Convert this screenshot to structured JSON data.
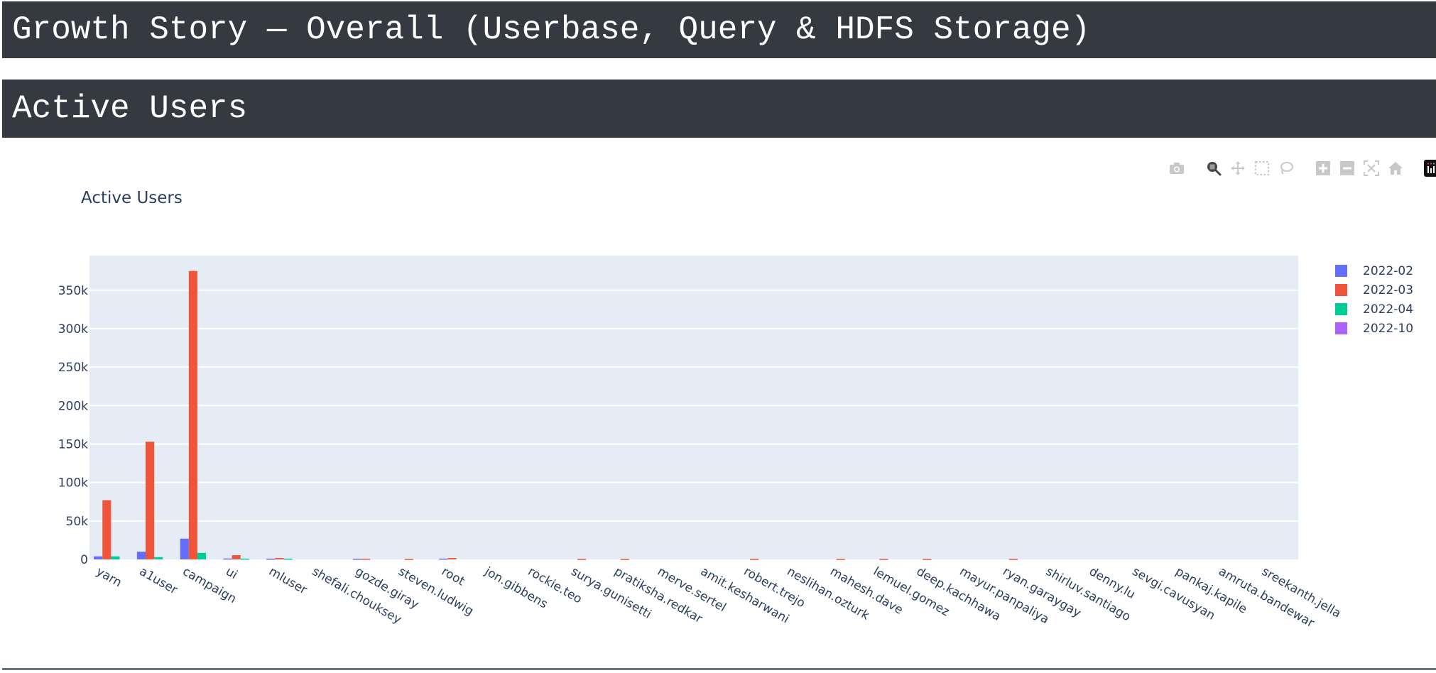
{
  "page": {
    "banner_title": "Growth Story — Overall (Userbase, Query & HDFS Storage)",
    "section_title": "Active Users"
  },
  "modebar": {
    "buttons": [
      {
        "name": "download-plot-as-png",
        "icon": "camera-icon"
      },
      {
        "name": "zoom",
        "icon": "zoom-icon",
        "active": true
      },
      {
        "name": "pan",
        "icon": "pan-icon"
      },
      {
        "name": "box-select",
        "icon": "box-select-icon"
      },
      {
        "name": "lasso-select",
        "icon": "lasso-icon"
      },
      {
        "name": "zoom-in",
        "icon": "zoom-in-icon"
      },
      {
        "name": "zoom-out",
        "icon": "zoom-out-icon"
      },
      {
        "name": "autoscale",
        "icon": "autoscale-icon"
      },
      {
        "name": "reset-axes",
        "icon": "home-icon"
      },
      {
        "name": "plotly-logo",
        "icon": "plotly-logo-icon"
      }
    ]
  },
  "chart_data": {
    "type": "bar",
    "barmode": "group",
    "title": "Active Users",
    "xlabel": "",
    "ylabel": "",
    "ylim": [
      0,
      395000
    ],
    "yticks": [
      0,
      50000,
      100000,
      150000,
      200000,
      250000,
      300000,
      350000
    ],
    "ytick_labels": [
      "0",
      "50k",
      "100k",
      "150k",
      "200k",
      "250k",
      "300k",
      "350k"
    ],
    "grid": true,
    "legend_position": "top-right",
    "categories": [
      "yarn",
      "a1user",
      "campaign",
      "ui",
      "mluser",
      "shefali.chouksey",
      "gozde.giray",
      "steven.ludwig",
      "root",
      "jon.gibbens",
      "rockie.teo",
      "surya.gunisetti",
      "pratiksha.redkar",
      "merve.sertel",
      "amit.kesharwani",
      "robert.trejo",
      "neslihan.ozturk",
      "mahesh.dave",
      "lemuel.gomez",
      "deep.kachhawa",
      "mayur.panpaliya",
      "ryan.garaygay",
      "shirluv.santiago",
      "denny.lu",
      "sevgi.cavusyan",
      "pankaj.kapile",
      "amruta.bandewar",
      "sreekanth.jella"
    ],
    "series": [
      {
        "name": "2022-02",
        "color": "#636efa",
        "values": [
          4000,
          10000,
          27000,
          1200,
          1000,
          0,
          900,
          0,
          1000,
          0,
          0,
          0,
          0,
          0,
          0,
          0,
          0,
          0,
          0,
          0,
          0,
          0,
          0,
          0,
          0,
          0,
          0,
          0
        ]
      },
      {
        "name": "2022-03",
        "color": "#ef553b",
        "values": [
          77000,
          153000,
          375000,
          5500,
          1800,
          0,
          900,
          700,
          1800,
          0,
          0,
          700,
          700,
          0,
          0,
          700,
          0,
          700,
          700,
          700,
          0,
          700,
          0,
          0,
          0,
          0,
          0,
          0
        ]
      },
      {
        "name": "2022-04",
        "color": "#00cc96",
        "values": [
          4000,
          3000,
          8500,
          1000,
          1000,
          0,
          0,
          0,
          0,
          0,
          0,
          0,
          0,
          0,
          0,
          0,
          0,
          0,
          0,
          0,
          0,
          0,
          0,
          0,
          0,
          0,
          0,
          0
        ]
      },
      {
        "name": "2022-10",
        "color": "#ab63fa",
        "values": [
          0,
          0,
          0,
          0,
          0,
          0,
          0,
          0,
          0,
          0,
          0,
          0,
          0,
          0,
          0,
          0,
          0,
          0,
          0,
          0,
          0,
          0,
          0,
          0,
          0,
          0,
          0,
          0
        ]
      }
    ]
  }
}
